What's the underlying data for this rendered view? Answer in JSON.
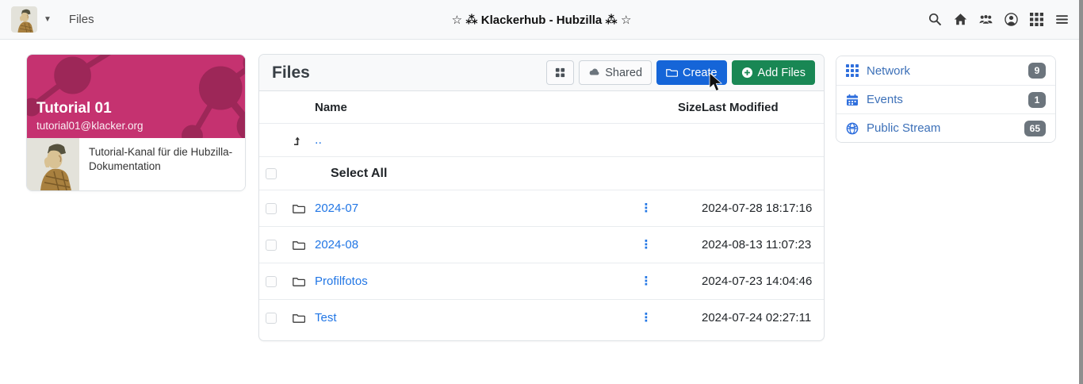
{
  "navbar": {
    "channel_menu_label": "Files",
    "app_title": "☆ ⁂ Klackerhub - Hubzilla ⁂ ☆"
  },
  "profile_card": {
    "title": "Tutorial 01",
    "address": "tutorial01@klacker.org",
    "description": "Tutorial-Kanal für die Hubzilla-Dokumentation"
  },
  "files": {
    "title": "Files",
    "shared_label": "Shared",
    "create_label": "Create",
    "add_files_label": "Add Files",
    "col_name": "Name",
    "col_size": "Size",
    "col_modified": "Last Modified",
    "parent_link": "..",
    "select_all_label": "Select All",
    "rows": [
      {
        "name": "2024-07",
        "size": "",
        "modified": "2024-07-28 18:17:16"
      },
      {
        "name": "2024-08",
        "size": "",
        "modified": "2024-08-13 11:07:23"
      },
      {
        "name": "Profilfotos",
        "size": "",
        "modified": "2024-07-23 14:04:46"
      },
      {
        "name": "Test",
        "size": "",
        "modified": "2024-07-24 02:27:11"
      }
    ]
  },
  "sidebar_right": {
    "items": [
      {
        "label": "Network",
        "badge": "9"
      },
      {
        "label": "Events",
        "badge": "1"
      },
      {
        "label": "Public Stream",
        "badge": "65"
      }
    ]
  },
  "colors": {
    "primary_blue": "#1565d8",
    "success_green": "#198754",
    "link_blue": "#2176e5",
    "header_magenta": "#c53270",
    "header_magenta_dark": "#9d2758",
    "badge_gray": "#6c757d"
  }
}
